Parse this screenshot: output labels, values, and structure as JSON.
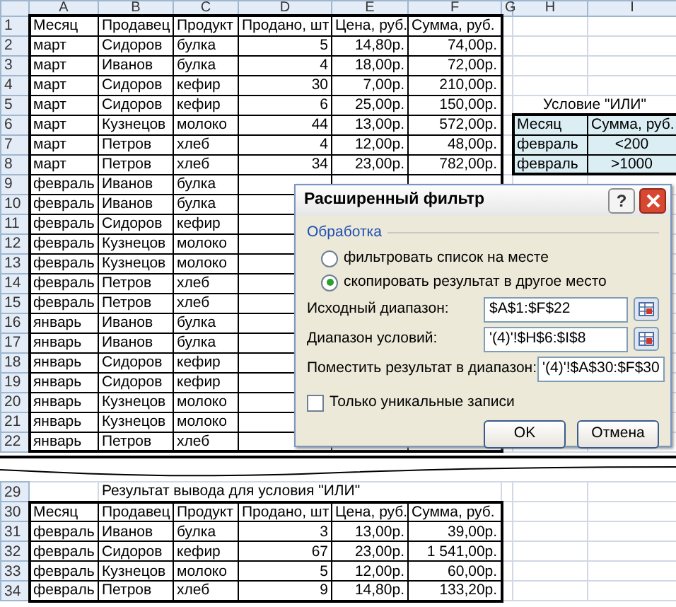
{
  "sheet": {
    "columns": [
      "A",
      "B",
      "C",
      "D",
      "E",
      "F",
      "G",
      "H",
      "I"
    ],
    "upper_rows": [
      {
        "n": "1",
        "cells": {
          "A": "Месяц",
          "B": "Продавец",
          "C": "Продукт",
          "D": "Продано, шт",
          "E": "Цена, руб.",
          "F": "Сумма, руб."
        }
      },
      {
        "n": "2",
        "cells": {
          "A": "март",
          "B": "Сидоров",
          "C": "булка",
          "D": "5",
          "E": "14,80р.",
          "F": "74,00р."
        }
      },
      {
        "n": "3",
        "cells": {
          "A": "март",
          "B": "Иванов",
          "C": "булка",
          "D": "4",
          "E": "18,00р.",
          "F": "72,00р."
        }
      },
      {
        "n": "4",
        "cells": {
          "A": "март",
          "B": "Сидоров",
          "C": "кефир",
          "D": "30",
          "E": "7,00р.",
          "F": "210,00р."
        }
      },
      {
        "n": "5",
        "cells": {
          "A": "март",
          "B": "Сидоров",
          "C": "кефир",
          "D": "6",
          "E": "25,00р.",
          "F": "150,00р.",
          "H": "Условие \"ИЛИ\""
        }
      },
      {
        "n": "6",
        "cells": {
          "A": "март",
          "B": "Кузнецов",
          "C": "молоко",
          "D": "44",
          "E": "13,00р.",
          "F": "572,00р.",
          "H": "Месяц",
          "I": "Сумма, руб."
        }
      },
      {
        "n": "7",
        "cells": {
          "A": "март",
          "B": "Петров",
          "C": "хлеб",
          "D": "4",
          "E": "12,00р.",
          "F": "48,00р.",
          "H": "февраль",
          "I": "<200"
        }
      },
      {
        "n": "8",
        "cells": {
          "A": "март",
          "B": "Петров",
          "C": "хлеб",
          "D": "34",
          "E": "23,00р.",
          "F": "782,00р.",
          "H": "февраль",
          "I": ">1000"
        }
      },
      {
        "n": "9",
        "cells": {
          "A": "февраль",
          "B": "Иванов",
          "C": "булка"
        }
      },
      {
        "n": "10",
        "cells": {
          "A": "февраль",
          "B": "Иванов",
          "C": "булка"
        }
      },
      {
        "n": "11",
        "cells": {
          "A": "февраль",
          "B": "Сидоров",
          "C": "кефир"
        }
      },
      {
        "n": "12",
        "cells": {
          "A": "февраль",
          "B": "Кузнецов",
          "C": "молоко"
        }
      },
      {
        "n": "13",
        "cells": {
          "A": "февраль",
          "B": "Кузнецов",
          "C": "молоко"
        }
      },
      {
        "n": "14",
        "cells": {
          "A": "февраль",
          "B": "Петров",
          "C": "хлеб"
        }
      },
      {
        "n": "15",
        "cells": {
          "A": "февраль",
          "B": "Петров",
          "C": "хлеб"
        }
      },
      {
        "n": "16",
        "cells": {
          "A": "январь",
          "B": "Иванов",
          "C": "булка"
        }
      },
      {
        "n": "17",
        "cells": {
          "A": "январь",
          "B": "Иванов",
          "C": "булка"
        }
      },
      {
        "n": "18",
        "cells": {
          "A": "январь",
          "B": "Сидоров",
          "C": "кефир"
        }
      },
      {
        "n": "19",
        "cells": {
          "A": "январь",
          "B": "Сидоров",
          "C": "кефир"
        }
      },
      {
        "n": "20",
        "cells": {
          "A": "январь",
          "B": "Кузнецов",
          "C": "молоко"
        }
      },
      {
        "n": "21",
        "cells": {
          "A": "январь",
          "B": "Кузнецов",
          "C": "молоко"
        }
      },
      {
        "n": "22",
        "cells": {
          "A": "январь",
          "B": "Петров",
          "C": "хлеб"
        }
      }
    ],
    "lower_rows": [
      {
        "n": "29",
        "cells": {
          "B": "Результат вывода для условия \"ИЛИ\""
        }
      },
      {
        "n": "30",
        "cells": {
          "A": "Месяц",
          "B": "Продавец",
          "C": "Продукт",
          "D": "Продано, шт",
          "E": "Цена, руб.",
          "F": "Сумма, руб."
        }
      },
      {
        "n": "31",
        "cells": {
          "A": "февраль",
          "B": "Иванов",
          "C": "булка",
          "D": "3",
          "E": "13,00р.",
          "F": "39,00р."
        }
      },
      {
        "n": "32",
        "cells": {
          "A": "февраль",
          "B": "Сидоров",
          "C": "кефир",
          "D": "67",
          "E": "23,00р.",
          "F": "1 541,00р."
        }
      },
      {
        "n": "33",
        "cells": {
          "A": "февраль",
          "B": "Кузнецов",
          "C": "молоко",
          "D": "5",
          "E": "12,00р.",
          "F": "60,00р."
        }
      },
      {
        "n": "34",
        "cells": {
          "A": "февраль",
          "B": "Петров",
          "C": "хлеб",
          "D": "9",
          "E": "14,80р.",
          "F": "133,20р."
        }
      }
    ]
  },
  "dialog": {
    "title": "Расширенный фильтр",
    "help_button": "?",
    "group": "Обработка",
    "radios": [
      {
        "label": "фильтровать список на месте",
        "selected": false
      },
      {
        "label": "скопировать результат в другое место",
        "selected": true
      }
    ],
    "fields": [
      {
        "label": "Исходный диапазон:",
        "value": "$A$1:$F$22"
      },
      {
        "label": "Диапазон условий:",
        "value": "'(4)'!$H$6:$I$8"
      },
      {
        "label": "Поместить результат в диапазон:",
        "value": "'(4)'!$A$30:$F$30"
      }
    ],
    "checkbox": {
      "label": "Только уникальные записи",
      "checked": false
    },
    "buttons": [
      "OK",
      "Отмена"
    ]
  }
}
